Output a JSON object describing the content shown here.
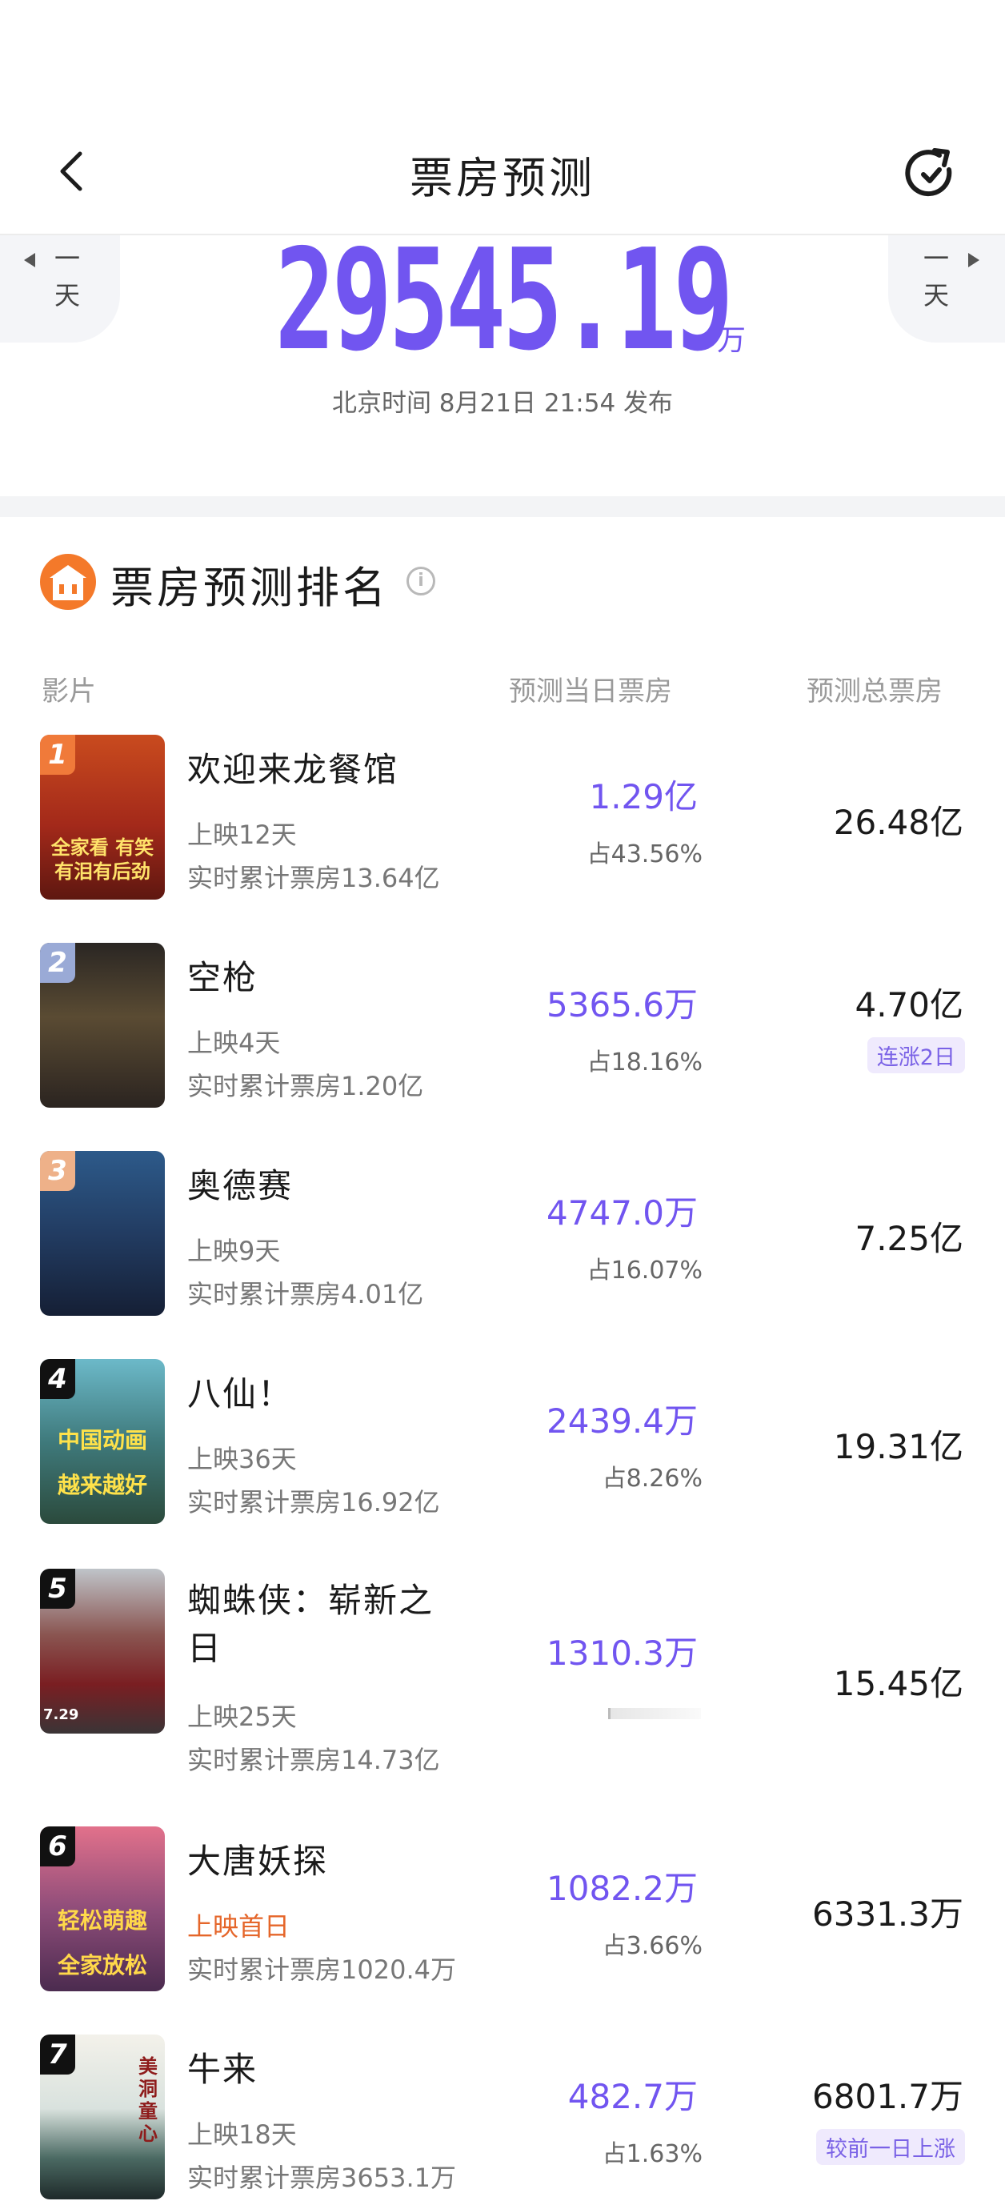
{
  "header": {
    "title": "票房预测",
    "back_icon": "chevron-left-icon",
    "refresh_icon": "refresh-icon"
  },
  "day_nav": {
    "prev_label": "一天",
    "next_label": "一天"
  },
  "total": {
    "value": "29545.19",
    "unit": "万",
    "publish_text": "北京时间 8月21日 21:54 发布"
  },
  "section": {
    "title": "票房预测排名",
    "info_icon": "info-icon"
  },
  "columns": {
    "film": "影片",
    "day": "预测当日票房",
    "total": "预测总票房"
  },
  "films": [
    {
      "rank": "1",
      "name": "欢迎来龙餐馆",
      "release": "上映12天",
      "cumulative": "实时累计票房13.64亿",
      "pred_day": "1.29亿",
      "share": "占43.56%",
      "pred_total": "26.48亿",
      "badge": "",
      "poster_caption": "全家看 有笑有泪有后劲"
    },
    {
      "rank": "2",
      "name": "空枪",
      "release": "上映4天",
      "cumulative": "实时累计票房1.20亿",
      "pred_day": "5365.6万",
      "share": "占18.16%",
      "pred_total": "4.70亿",
      "badge": "连涨2日",
      "poster_caption": ""
    },
    {
      "rank": "3",
      "name": "奥德赛",
      "release": "上映9天",
      "cumulative": "实时累计票房4.01亿",
      "pred_day": "4747.0万",
      "share": "占16.07%",
      "pred_total": "7.25亿",
      "badge": "",
      "poster_caption": ""
    },
    {
      "rank": "4",
      "name": "八仙！",
      "release": "上映36天",
      "cumulative": "实时累计票房16.92亿",
      "pred_day": "2439.4万",
      "share": "占8.26%",
      "pred_total": "19.31亿",
      "badge": "",
      "poster_caption": "中国动画 越来越好"
    },
    {
      "rank": "5",
      "name": "蜘蛛侠：崭新之日",
      "release": "上映25天",
      "cumulative": "实时累计票房14.73亿",
      "pred_day": "1310.3万",
      "share": "",
      "pred_total": "15.45亿",
      "badge": "",
      "poster_caption": "7.29"
    },
    {
      "rank": "6",
      "name": "大唐妖探",
      "release": "上映首日",
      "cumulative": "实时累计票房1020.4万",
      "pred_day": "1082.2万",
      "share": "占3.66%",
      "pred_total": "6331.3万",
      "badge": "",
      "poster_caption": "轻松萌趣 全家放松"
    },
    {
      "rank": "7",
      "name": "牛来",
      "release": "上映18天",
      "cumulative": "实时累计票房3653.1万",
      "pred_day": "482.7万",
      "share": "占1.63%",
      "pred_total": "6801.7万",
      "badge": "较前一日上涨",
      "poster_caption": "美洞童心"
    }
  ]
}
